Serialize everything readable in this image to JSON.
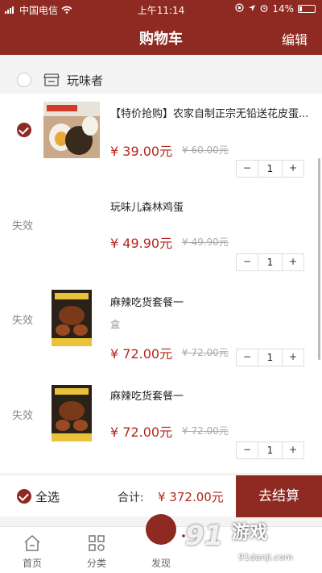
{
  "status": {
    "carrier": "中国电信",
    "time": "上午11:14",
    "battery": "14%"
  },
  "nav": {
    "title": "购物车",
    "edit": "编辑"
  },
  "shop": {
    "name": "玩味者"
  },
  "items": [
    {
      "name": "【特价抢购】农家自制正宗无铅送花皮蛋...",
      "spec": "",
      "price": "¥ 39.00元",
      "orig": "¥ 60.00元",
      "qty": "1",
      "status": "selected"
    },
    {
      "name": "玩味儿森林鸡蛋",
      "spec": "",
      "price": "¥ 49.90元",
      "orig": "¥ 49.90元",
      "qty": "1",
      "status": "失效"
    },
    {
      "name": "麻辣吃货套餐一",
      "spec": "盒",
      "price": "¥ 72.00元",
      "orig": "¥ 72.00元",
      "qty": "1",
      "status": "失效"
    },
    {
      "name": "麻辣吃货套餐一",
      "spec": "",
      "price": "¥ 72.00元",
      "orig": "¥ 72.00元",
      "qty": "1",
      "status": "失效"
    }
  ],
  "stepper": {
    "minus": "−",
    "plus": "+"
  },
  "footer": {
    "select_all": "全选",
    "total_label": "合计:",
    "total_value": "¥ 372.00元",
    "checkout": "去结算"
  },
  "tabs": [
    {
      "label": "首页"
    },
    {
      "label": "分类"
    },
    {
      "label": "发现"
    }
  ],
  "watermark": {
    "logo": "91",
    "big": "游戏",
    "small": "91danji.com"
  },
  "colors": {
    "brand": "#8e2a21",
    "price": "#b3261e"
  }
}
